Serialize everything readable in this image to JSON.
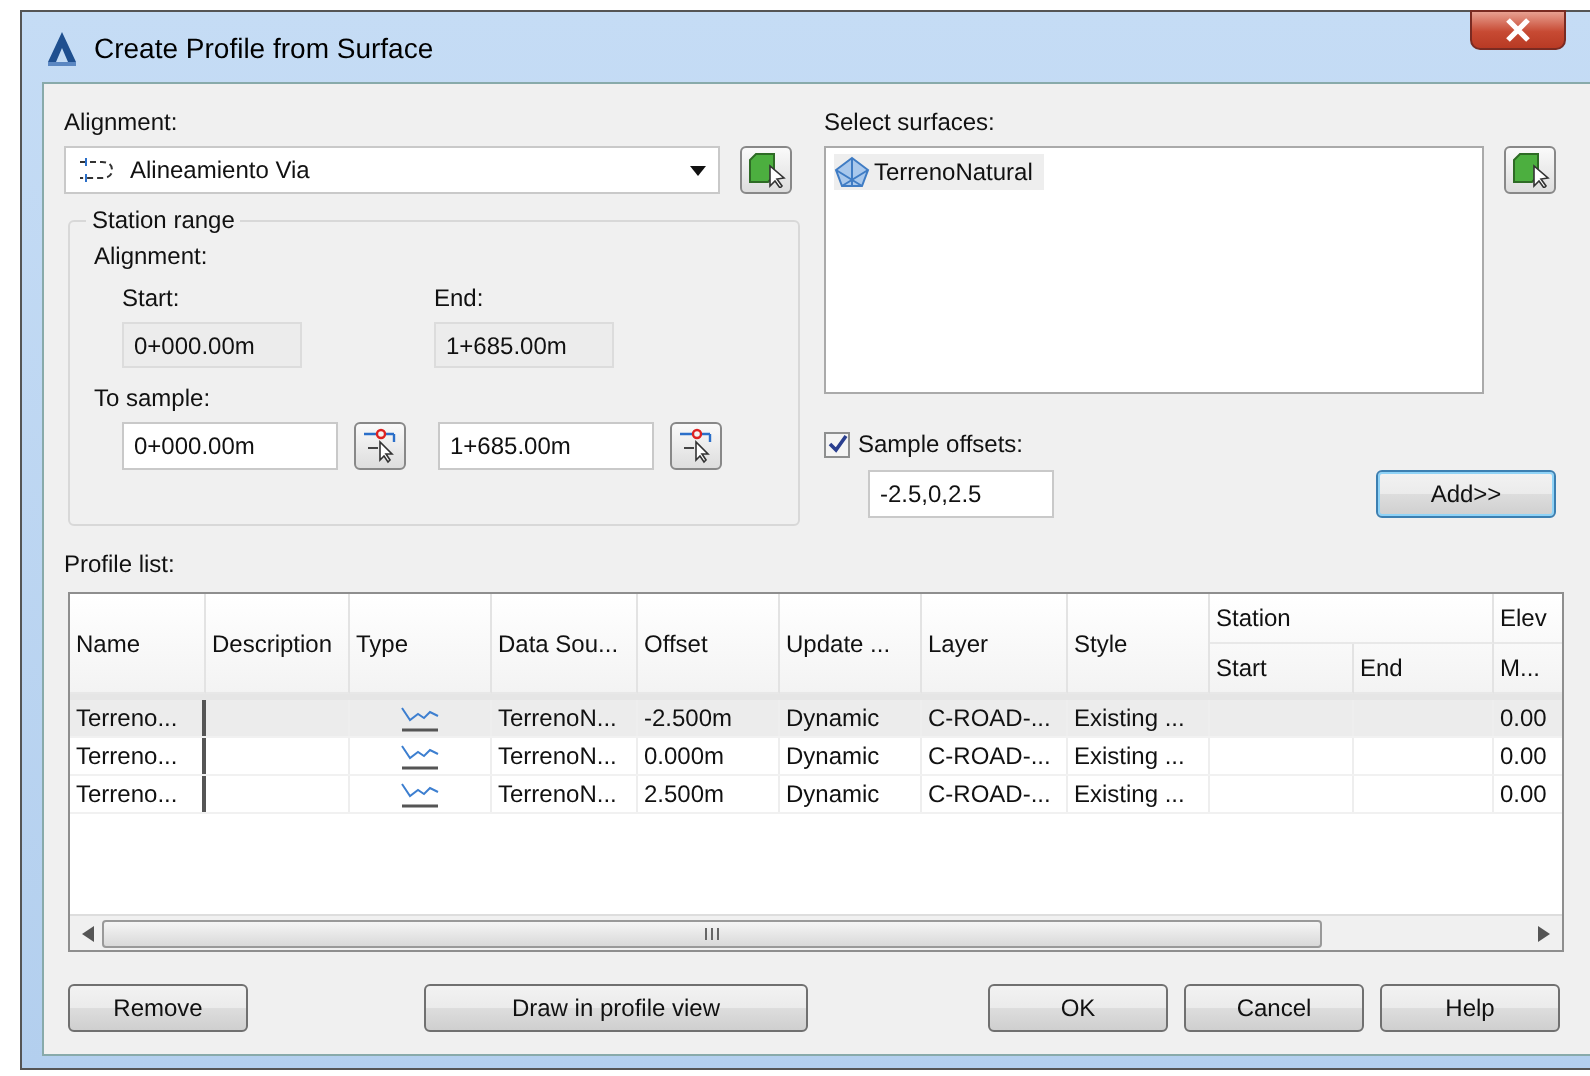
{
  "window": {
    "title": "Create Profile from Surface"
  },
  "alignment": {
    "label": "Alignment:",
    "value": "Alineamiento Via"
  },
  "station_range": {
    "title": "Station range",
    "alignment_label": "Alignment:",
    "start_label": "Start:",
    "start": "0+000.00m",
    "end_label": "End:",
    "end": "1+685.00m",
    "sample_label": "To sample:",
    "sample_start": "0+000.00m",
    "sample_end": "1+685.00m"
  },
  "surfaces": {
    "label": "Select surfaces:",
    "items": [
      {
        "name": "TerrenoNatural",
        "selected": true
      }
    ]
  },
  "sample_offsets": {
    "label": "Sample offsets:",
    "checked": true,
    "value": "-2.5,0,2.5"
  },
  "add_button": "Add>>",
  "profile_list": {
    "label": "Profile list:",
    "columns": [
      {
        "label": "Name"
      },
      {
        "label": "Description"
      },
      {
        "label": "Type"
      },
      {
        "label": "Data Sou..."
      },
      {
        "label": "Offset"
      },
      {
        "label": "Update ..."
      },
      {
        "label": "Layer"
      },
      {
        "label": "Style"
      },
      {
        "label": "Station",
        "children": [
          "Start",
          "End"
        ]
      },
      {
        "label": "Elev",
        "children": [
          "M..."
        ]
      }
    ],
    "rows": [
      {
        "name": "Terreno...",
        "data_source": "TerrenoN...",
        "offset": "-2.500m",
        "update": "Dynamic",
        "layer": "C-ROAD-...",
        "style": "Existing ...",
        "column_11": "0.00",
        "selected": true
      },
      {
        "name": "Terreno...",
        "data_source": "TerrenoN...",
        "offset": "0.000m",
        "update": "Dynamic",
        "layer": "C-ROAD-...",
        "style": "Existing ...",
        "column_11": "0.00",
        "selected": false
      },
      {
        "name": "Terreno...",
        "data_source": "TerrenoN...",
        "offset": "2.500m",
        "update": "Dynamic",
        "layer": "C-ROAD-...",
        "style": "Existing ...",
        "column_11": "0.00",
        "selected": false
      }
    ]
  },
  "buttons": [
    "Remove",
    "Draw in profile view",
    "OK",
    "Cancel",
    "Help"
  ]
}
